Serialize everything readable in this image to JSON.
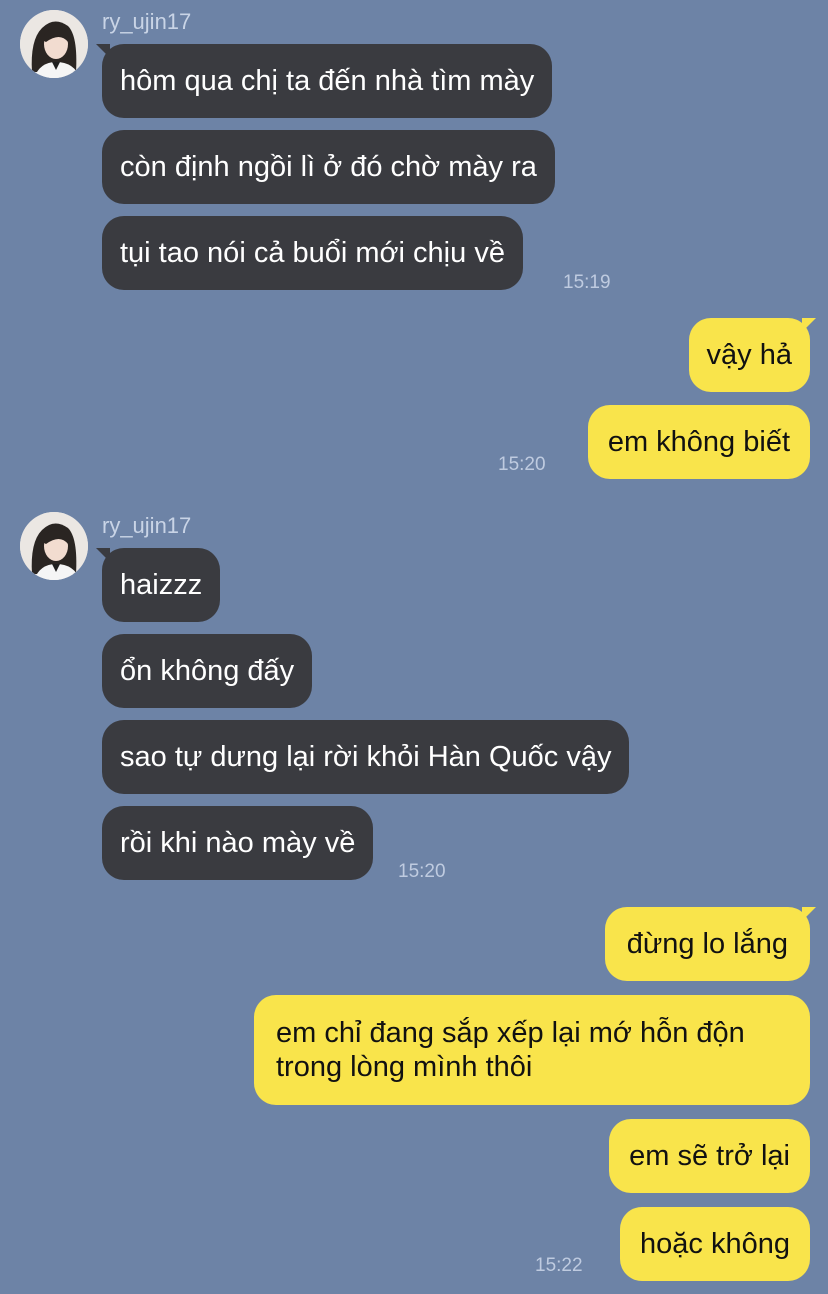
{
  "groups": [
    {
      "sender": "ry_ujin17",
      "messages": [
        "hôm qua chị ta đến nhà tìm mày",
        "còn định ngồi lì ở đó chờ mày ra",
        "tụi tao nói cả buổi mới chịu về"
      ],
      "time": "15:19"
    },
    {
      "sender": "me",
      "messages": [
        "vậy hả",
        "em không biết"
      ],
      "time": "15:20"
    },
    {
      "sender": "ry_ujin17",
      "messages": [
        "haizzz",
        "ổn không đấy",
        "sao tự dưng lại rời khỏi Hàn Quốc vậy",
        "rồi khi nào mày về"
      ],
      "time": "15:20"
    },
    {
      "sender": "me",
      "messages": [
        "đừng lo lắng",
        "em chỉ đang sắp xếp lại mớ hỗn độn trong lòng mình thôi",
        "em sẽ trở lại",
        "hoặc không"
      ],
      "time": "15:22"
    }
  ],
  "colors": {
    "background": "#6d83a6",
    "incoming_bubble": "#3a3b40",
    "outgoing_bubble": "#f9e44b"
  },
  "icons": {
    "avatar": "profile-photo"
  }
}
